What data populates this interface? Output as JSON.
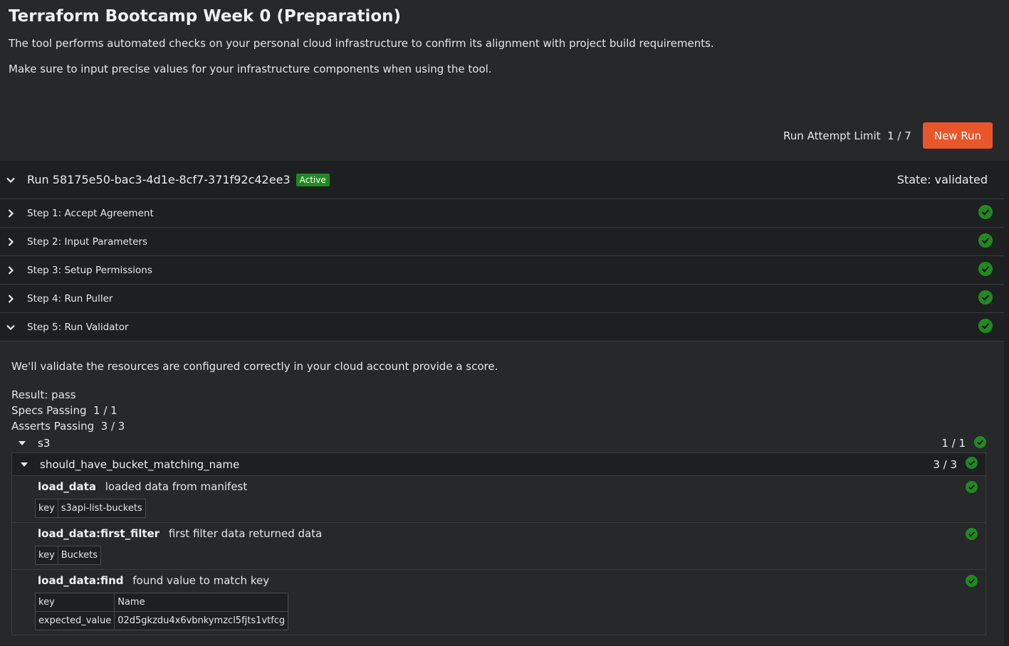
{
  "page": {
    "title": "Terraform Bootcamp Week 0 (Preparation)",
    "description_1": "The tool performs automated checks on your personal cloud infrastructure to confirm its alignment with project build requirements.",
    "description_2": "Make sure to input precise values for your infrastructure components when using the tool."
  },
  "controls": {
    "attempt_limit": "Run Attempt Limit  1 / 7",
    "new_run_label": "New Run"
  },
  "run": {
    "title": "Run 58175e50-bac3-4d1e-8cf7-371f92c42ee3",
    "badge": "Active",
    "state": "State: validated"
  },
  "steps": [
    {
      "label": "Step 1: Accept Agreement",
      "expanded": false,
      "status": "success"
    },
    {
      "label": "Step 2: Input Parameters",
      "expanded": false,
      "status": "success"
    },
    {
      "label": "Step 3: Setup Permissions",
      "expanded": false,
      "status": "success"
    },
    {
      "label": "Step 4: Run Puller",
      "expanded": false,
      "status": "success"
    },
    {
      "label": "Step 5: Run Validator",
      "expanded": true,
      "status": "success"
    }
  ],
  "validator": {
    "description": "We'll validate the resources are configured correctly in your cloud account provide a score.",
    "result": "Result: pass",
    "specs_passing": "Specs Passing  1 / 1",
    "asserts_passing": "Asserts Passing  3 / 3",
    "group": {
      "name": "s3",
      "count": "1 / 1"
    },
    "spec": {
      "name": "should_have_bucket_matching_name",
      "count": "3 / 3"
    },
    "asserts": [
      {
        "name": "load_data",
        "message": "loaded data from manifest",
        "key_label": "key",
        "key_value": "s3api-list-buckets"
      },
      {
        "name": "load_data:first_filter",
        "message": "first filter data returned data",
        "key_label": "key",
        "key_value": "Buckets"
      },
      {
        "name": "load_data:find",
        "message": "found value to match key",
        "key_label": "key",
        "key_value": "Name",
        "expected_label": "expected_value",
        "expected_value": "02d5gkzdu4x6vbnkymzcl5fjts1vtfcg"
      }
    ]
  },
  "colors": {
    "accent": "#e8562a",
    "success": "#1f8a1f",
    "background": "#1e1f21",
    "panel": "#27282a"
  },
  "icons": {
    "chevron_down": "chevron-down-icon",
    "chevron_right": "chevron-right-icon",
    "check": "check-circle-icon",
    "caret_down": "caret-down-icon"
  }
}
